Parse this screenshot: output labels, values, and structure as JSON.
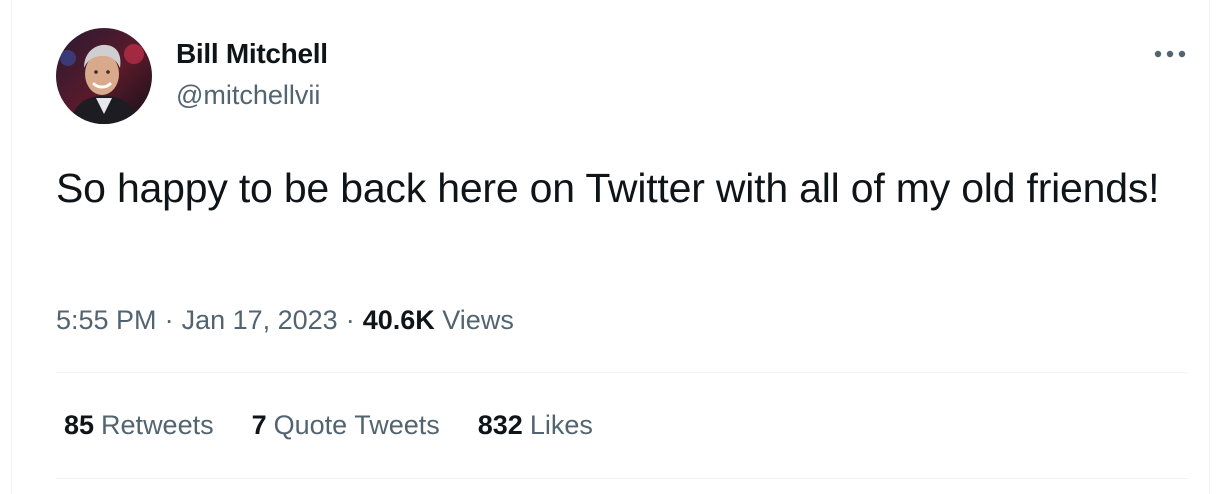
{
  "author": {
    "display_name": "Bill Mitchell",
    "handle": "@mitchellvii",
    "avatar_icon": "profile-photo"
  },
  "tweet": {
    "text": "So happy to be back here on Twitter with all of my old friends!",
    "time": "5:55 PM",
    "date": "Jan 17, 2023",
    "views_count": "40.6K",
    "views_label": "Views",
    "separator": "·"
  },
  "stats": {
    "retweets_count": "85",
    "retweets_label": "Retweets",
    "quotes_count": "7",
    "quotes_label": "Quote Tweets",
    "likes_count": "832",
    "likes_label": "Likes"
  },
  "icons": {
    "more": "more-horizontal-icon"
  },
  "colors": {
    "text_primary": "#0f1419",
    "text_secondary": "#536471",
    "divider": "#eff3f4"
  }
}
